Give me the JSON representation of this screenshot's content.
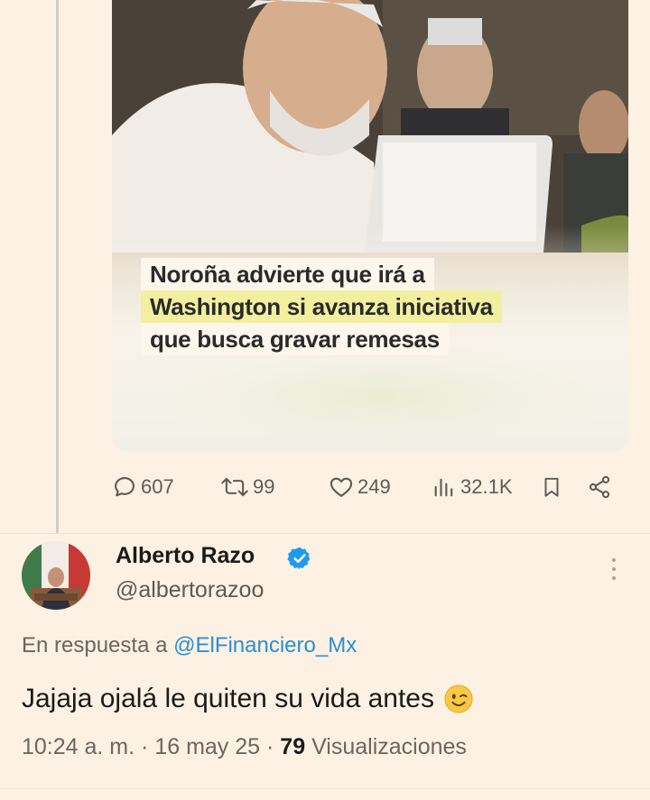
{
  "post": {
    "headline_lines": [
      "Noroña advierte que irá a",
      "Washington si avanza iniciativa",
      "que busca gravar remesas"
    ],
    "actions": {
      "replies": "607",
      "reposts": "99",
      "likes": "249",
      "views": "32.1K"
    }
  },
  "reply": {
    "author_name": "Alberto Razo",
    "author_handle": "@albertorazoo",
    "reply_prefix": "En respuesta a",
    "reply_to": "@ElFinanciero_Mx",
    "text": "Jajaja ojalá le quiten su vida antes",
    "time": "10:24 a. m.",
    "sep1": "·",
    "date": "16 may 25",
    "sep2": "·",
    "views_count": "79",
    "views_label": "Visualizaciones",
    "emoji": "winking-face",
    "colors": {
      "background": "#fcf1e3",
      "link": "#2a8fd6",
      "verified": "#1d9bf0",
      "highlight": "#f2f0a0"
    }
  }
}
